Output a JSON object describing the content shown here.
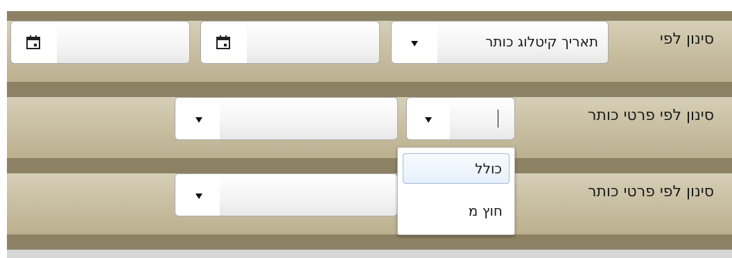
{
  "filters": [
    {
      "label": "סינון לפי",
      "field_select": {
        "value": "תאריך קיטלוג כותר"
      },
      "date_from": {
        "value": "",
        "icon": "calendar-icon"
      },
      "date_to": {
        "value": "",
        "icon": "calendar-icon"
      }
    },
    {
      "label": "סינון לפי פרטי כותר",
      "operator_select": {
        "value": ""
      },
      "value_select": {
        "value": ""
      }
    },
    {
      "label": "סינון לפי פרטי כותר",
      "value_select": {
        "value": ""
      }
    }
  ],
  "operator_dropdown": {
    "options": [
      {
        "label": "כולל",
        "selected": true
      },
      {
        "label": "חוץ מ",
        "selected": false
      }
    ]
  },
  "colors": {
    "panel": "#8c8163",
    "row": "#c7bd9f",
    "selected_option_border": "#9fbbd8"
  }
}
